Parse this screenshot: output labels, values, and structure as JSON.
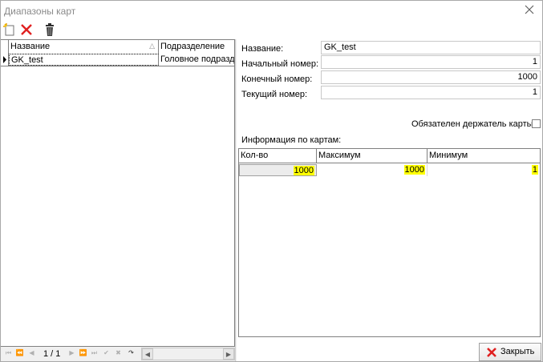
{
  "window": {
    "title": "Диапазоны карт"
  },
  "left_grid": {
    "columns": [
      "Название",
      "Подразделение"
    ],
    "rows": [
      {
        "name": "GK_test",
        "division": "Головное подразделение"
      }
    ]
  },
  "navigator": {
    "page": "1 / 1"
  },
  "form": {
    "name_label": "Название:",
    "name_value": "GK_test",
    "start_label": "Начальный номер:",
    "start_value": "1",
    "end_label": "Конечный номер:",
    "end_value": "1000",
    "current_label": "Текущий номер:",
    "current_value": "1",
    "holder_required_label": "Обязателен держатель карты",
    "info_label": "Информация по картам:"
  },
  "card_info": {
    "columns": [
      "Кол-во",
      "Максимум",
      "Минимум"
    ],
    "row": {
      "count": "1000",
      "max": "1000",
      "min": "1"
    }
  },
  "buttons": {
    "close_label": "Закрыть"
  },
  "colors": {
    "highlight": "#ffff00",
    "delete_red": "#e02020"
  }
}
